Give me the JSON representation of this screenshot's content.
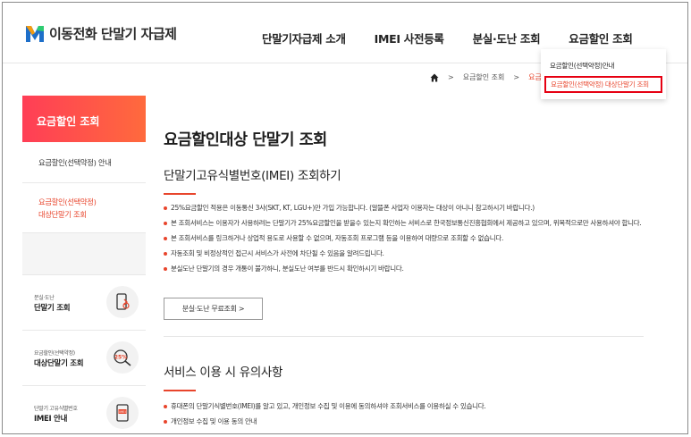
{
  "header": {
    "logo_text": "이동전화 단말기 자급제",
    "nav": [
      {
        "label": "단말기자급제 소개"
      },
      {
        "label": "IMEI 사전등록"
      },
      {
        "label": "분실·도난 조회"
      },
      {
        "label": "요금할인 조회"
      }
    ]
  },
  "dropdown": {
    "item1": "요금할인(선택약정)안내",
    "item2": "요금할인(선택약정) 대상단말기 조회"
  },
  "breadcrumb": {
    "sep": ">",
    "item1": "요금할인 조회",
    "current": "요금"
  },
  "sidebar": {
    "title": "요금할인 조회",
    "menu": [
      {
        "label": "요금할인(선택약정) 안내"
      },
      {
        "line1": "요금할인(선택약정)",
        "line2": "대상단말기 조회"
      }
    ],
    "cards": [
      {
        "sub": "분실·도난",
        "main": "단말기 조회",
        "icon": "phone-search-icon"
      },
      {
        "sub": "요금할인(선택약정)",
        "main": "대상단말기 조회",
        "icon": "discount-search-icon",
        "badge": "25%"
      },
      {
        "sub": "단말기 고유식별번호",
        "main": "IMEI 안내",
        "icon": "imei-phone-icon",
        "badge": "IMEI"
      }
    ]
  },
  "main": {
    "page_title": "요금할인대상 단말기 조회",
    "section1_title": "단말기고유식별번호(IMEI) 조회하기",
    "bullets": [
      "25%요금할인 적용은 이동통신 3사(SKT, KT, LGU+)만 가입 가능합니다. (알뜰폰 사업자 이용자는 대상이 아니니 참고하시기 바랍니다.)",
      "본 조회서비스는 이용자가 사용하려는 단말기가 25%요금할인을 받을수 있는지 확인하는 서비스로 한국정보통신진흥협회에서 제공하고 있으며, 위목적으로만 사용하셔야 합니다.",
      "본 조회서비스를 링크하거나 상업적 용도로 사용할 수 없으며, 자동조회 프로그램 등을 이용하여 대량으로 조회할 수 없습니다.",
      "자동조회 및 비정상적인 접근시 서비스가 사전에 차단될 수 있음을 알려드립니다.",
      "분실도난 단말기의 경우 개통이 불가하니, 분실도난 여부를 반드시 확인하시기 바랍니다."
    ],
    "button_label": "분실·도난 무료조회 >",
    "section2_title": "서비스 이용 시 유의사항",
    "bullets2": [
      "휴대폰의 단말기식별번호(IMEI)를 알고 있고, 개인정보 수집 및 이용에 동의하셔야 조회서비스를 이용하실 수 있습니다.",
      "개인정보 수집 및 이용 동의 안내"
    ]
  },
  "colors": {
    "accent": "#e8452c",
    "highlight_border": "#e60012"
  }
}
